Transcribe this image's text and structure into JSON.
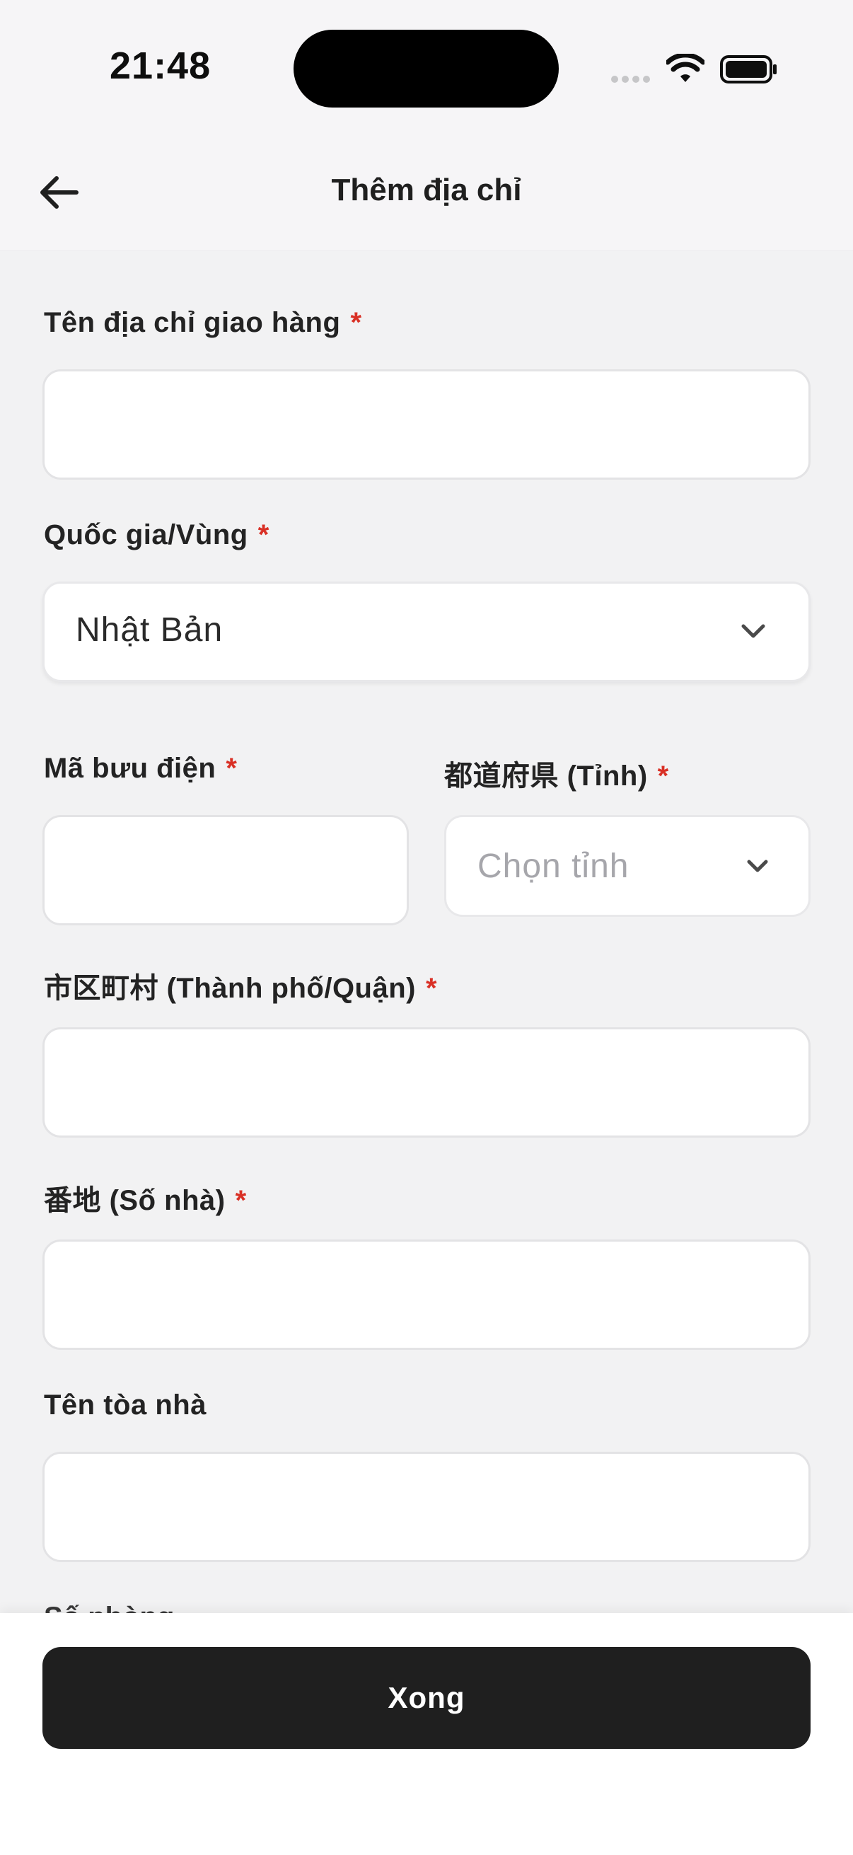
{
  "status_bar": {
    "time": "21:48"
  },
  "header": {
    "title": "Thêm địa chỉ"
  },
  "form": {
    "required_mark": "*",
    "address_name": {
      "label": "Tên địa chỉ giao hàng",
      "value": ""
    },
    "country": {
      "label": "Quốc gia/Vùng",
      "value": "Nhật Bản"
    },
    "postal_code": {
      "label": "Mã bưu điện",
      "value": ""
    },
    "prefecture": {
      "label": "都道府県 (Tỉnh)",
      "placeholder": "Chọn tỉnh"
    },
    "city": {
      "label": "市区町村 (Thành phố/Quận)",
      "value": ""
    },
    "street_number": {
      "label": "番地 (Số nhà)",
      "value": ""
    },
    "building_name": {
      "label": "Tên tòa nhà",
      "value": ""
    },
    "room_number": {
      "label": "Số phòng"
    }
  },
  "footer": {
    "done_label": "Xong"
  },
  "colors": {
    "primary_button": "#1f1f1f",
    "required": "#d93025",
    "background": "#f2f2f3"
  },
  "icons": [
    "back-arrow-icon",
    "chevron-down-icon",
    "wifi-icon",
    "battery-icon",
    "cellular-signal-icon"
  ]
}
